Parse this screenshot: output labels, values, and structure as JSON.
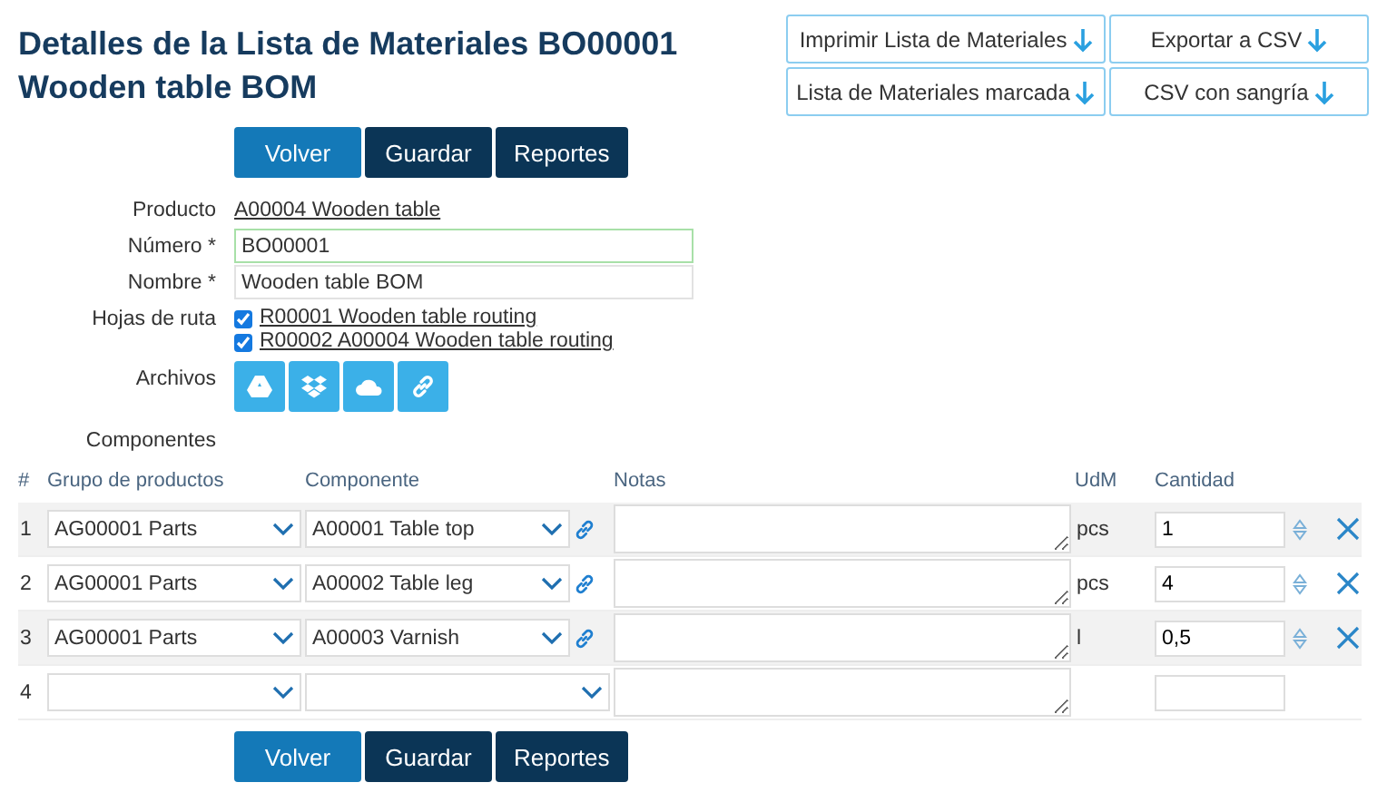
{
  "title": [
    "Detalles de la Lista de Materiales BO00001",
    "Wooden table BOM"
  ],
  "export_buttons": [
    "Imprimir Lista de Materiales",
    "Exportar a CSV",
    "Lista de Materiales marcada",
    "CSV con sangría"
  ],
  "actions_top": [
    {
      "label": "Volver",
      "kind": "primary"
    },
    {
      "label": "Guardar",
      "kind": "dark"
    },
    {
      "label": "Reportes",
      "kind": "dark"
    }
  ],
  "form": {
    "product": {
      "label": "Producto",
      "value": "A00004 Wooden table"
    },
    "number": {
      "label": "Número *",
      "value": "BO00001",
      "focused": true
    },
    "name": {
      "label": "Nombre *",
      "value": "Wooden table BOM",
      "focused": false
    },
    "routings": {
      "label": "Hojas de ruta",
      "items": [
        {
          "text": "R00001 Wooden table routing",
          "checked": true
        },
        {
          "text": "R00002 A00004 Wooden table routing",
          "checked": true
        }
      ]
    },
    "files": {
      "label": "Archivos",
      "buttons": [
        {
          "kind": "drive"
        },
        {
          "kind": "dropbox"
        },
        {
          "kind": "cloud"
        },
        {
          "kind": "link"
        }
      ]
    },
    "components_label": "Componentes"
  },
  "table": {
    "columns": [
      "#",
      "Grupo de productos",
      "Componente",
      "Notas",
      "UdM",
      "Cantidad"
    ],
    "rows": [
      {
        "kind": "item",
        "index": "1",
        "group": "AG00001 Parts",
        "component": "A00001 Table top",
        "uom": "pcs",
        "quantity": "1"
      },
      {
        "kind": "item",
        "index": "2",
        "group": "AG00001 Parts",
        "component": "A00002 Table leg",
        "uom": "pcs",
        "quantity": "4"
      },
      {
        "kind": "item",
        "index": "3",
        "group": "AG00001 Parts",
        "component": "A00003 Varnish",
        "uom": "l",
        "quantity": "0,5"
      },
      {
        "kind": "new",
        "index": "4"
      }
    ]
  },
  "actions_bottom": [
    {
      "label": "Volver",
      "kind": "primary"
    },
    {
      "label": "Guardar",
      "kind": "dark"
    },
    {
      "label": "Reportes",
      "kind": "dark"
    }
  ]
}
